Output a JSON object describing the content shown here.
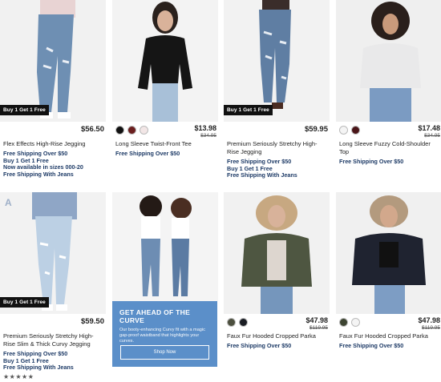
{
  "products": [
    {
      "name": "Flex Effects High-Rise Jegging",
      "price": "$56.50",
      "was": "",
      "badge": "Buy 1 Get 1 Free",
      "swatches": [],
      "promos": [
        "Free Shipping Over $50",
        "Buy 1 Get 1 Free",
        "Now available in sizes 000-20",
        "Free Shipping With Jeans"
      ]
    },
    {
      "name": "Long Sleeve Twist-Front Tee",
      "price": "$13.98",
      "was": "$34.95",
      "badge": "",
      "swatches": [
        "#111111",
        "#6b1e1e",
        "#f2e6e6"
      ],
      "promos": [
        "Free Shipping Over $50"
      ]
    },
    {
      "name": "Premium Seriously Stretchy High-Rise Jegging",
      "price": "$59.95",
      "was": "",
      "badge": "Buy 1 Get 1 Free",
      "swatches": [],
      "promos": [
        "Free Shipping Over $50",
        "Buy 1 Get 1 Free",
        "Free Shipping With Jeans"
      ]
    },
    {
      "name": "Long Sleeve Fuzzy Cold-Shoulder Top",
      "price": "$17.48",
      "was": "$34.95",
      "badge": "",
      "swatches": [
        "#f4f4f4",
        "#4a1518"
      ],
      "promos": [
        "Free Shipping Over $50"
      ]
    },
    {
      "name": "Premium Seriously Stretchy High-Rise Slim & Thick Curvy Jegging",
      "price": "$59.50",
      "was": "",
      "badge": "Buy 1 Get 1 Free",
      "swatches": [],
      "promos": [
        "Free Shipping Over $50",
        "Buy 1 Get 1 Free",
        "Free Shipping With Jeans"
      ],
      "stars": "★★★★★",
      "mark": "A"
    },
    {
      "name": "Faux Fur Hooded Cropped Parka",
      "price": "$47.98",
      "was": "$119.95",
      "badge": "",
      "swatches": [
        "#4c4f3e",
        "#1a1d24"
      ],
      "promos": [
        "Free Shipping Over $50"
      ]
    },
    {
      "name": "Faux Fur Hooded Cropped Parka",
      "price": "$47.98",
      "was": "$119.95",
      "badge": "",
      "swatches": [
        "#3d4431",
        "#f4f4f4"
      ],
      "promos": [
        "Free Shipping Over $50"
      ]
    }
  ],
  "ad": {
    "title": "GET AHEAD OF THE CURVE",
    "body": "Our booty-enhancing Curvy fit with a magic gap-proof waistband that highlights your curves.",
    "button": "Shop Now"
  },
  "colors": {
    "promo": "#1d3a66",
    "ad_bg": "#5b8fc9"
  }
}
